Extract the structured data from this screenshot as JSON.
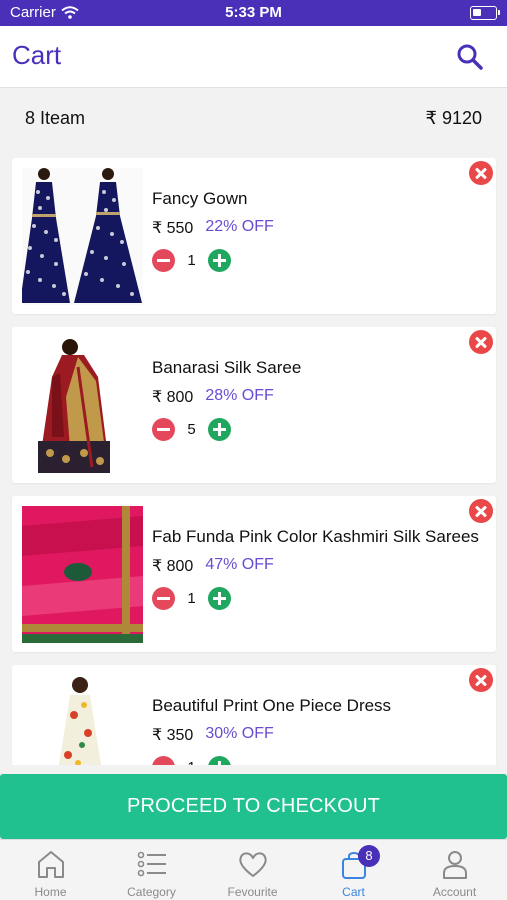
{
  "status_bar": {
    "carrier": "Carrier",
    "time": "5:33 PM"
  },
  "header": {
    "title": "Cart"
  },
  "summary": {
    "count": "8  Iteam",
    "total": "₹ 9120"
  },
  "items": [
    {
      "name": "Fancy Gown",
      "price": "₹ 550",
      "discount": "22% OFF",
      "qty": "1"
    },
    {
      "name": "Banarasi Silk Saree",
      "price": "₹ 800",
      "discount": "28% OFF",
      "qty": "5"
    },
    {
      "name": "Fab Funda Pink Color Kashmiri Silk Sarees",
      "price": "₹ 800",
      "discount": "47% OFF",
      "qty": "1"
    },
    {
      "name": "Beautiful Print One Piece Dress",
      "price": "₹ 350",
      "discount": "30% OFF",
      "qty": "1"
    }
  ],
  "checkout": {
    "label": "PROCEED TO CHECKOUT"
  },
  "tabs": [
    {
      "label": "Home",
      "icon": "home-icon"
    },
    {
      "label": "Category",
      "icon": "list-icon"
    },
    {
      "label": "Fevourite",
      "icon": "heart-icon"
    },
    {
      "label": "Cart",
      "icon": "bag-icon",
      "badge": "8"
    },
    {
      "label": "Account",
      "icon": "user-icon"
    }
  ],
  "colors": {
    "brand": "#4a2fb8",
    "accent": "#20c08f",
    "discount": "#6a4bd0",
    "remove": "#ea4848",
    "minus": "#e3495b",
    "plus": "#1fa65f",
    "active_tab": "#3b84e0"
  }
}
